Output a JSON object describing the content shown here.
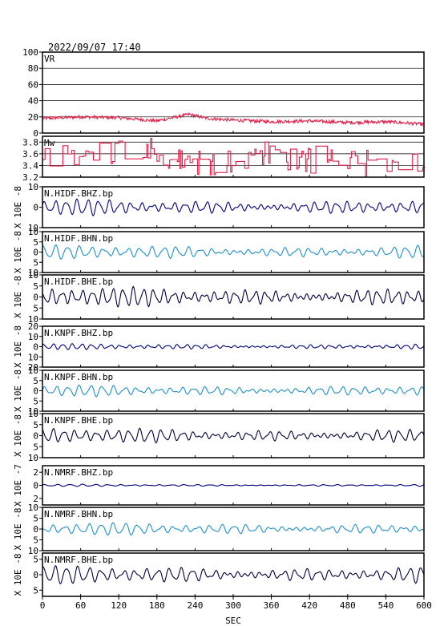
{
  "header": {
    "timestamp": "2022/09/07 17:40"
  },
  "chart_data": {
    "type": "line",
    "title": "",
    "xlabel": "SEC",
    "xlim": [
      0,
      600
    ],
    "xticks": [
      0,
      60,
      120,
      180,
      240,
      300,
      360,
      420,
      480,
      540,
      600
    ],
    "panels": [
      {
        "name": "VR",
        "ylim": [
          0,
          100
        ],
        "yticks": [
          0,
          20,
          40,
          60,
          80,
          100
        ],
        "ytick_labels": [
          "0",
          "20",
          "40",
          "60",
          "80",
          "100"
        ],
        "ylabel": "",
        "grid": true,
        "color": "#e0204a",
        "style": "vr",
        "series_summary": {
          "x": [
            0,
            60,
            120,
            180,
            230,
            260,
            300,
            360,
            420,
            480,
            540,
            600
          ],
          "y": [
            18,
            20,
            19,
            15,
            23,
            18,
            16,
            14,
            15,
            13,
            14,
            11
          ]
        }
      },
      {
        "name": "Mw",
        "ylim": [
          3.2,
          3.9
        ],
        "yticks": [
          3.2,
          3.4,
          3.6,
          3.8
        ],
        "ytick_labels": [
          "3.2",
          "3.4",
          "3.6",
          "3.8"
        ],
        "ylabel": "",
        "grid": true,
        "color": "#e0204a",
        "style": "mw",
        "series_summary": {
          "x": [
            0,
            100,
            150,
            200,
            300,
            360,
            420,
            480,
            540,
            600
          ],
          "y": [
            3.45,
            3.6,
            3.85,
            3.45,
            3.5,
            3.6,
            3.5,
            3.4,
            3.45,
            3.35
          ]
        }
      },
      {
        "name": "N.HIDF.BHZ.bp",
        "ylim": [
          -10,
          10
        ],
        "yticks": [
          -10,
          0,
          10
        ],
        "ytick_labels": [
          "10",
          "0",
          "10"
        ],
        "ylabel": "X 10E -8",
        "color": "#000080",
        "style": "obs",
        "amplitude": 3.5,
        "period_s": 17,
        "phase": 0.3,
        "series_summary": {
          "x": [
            0,
            600
          ],
          "y": [
            0,
            0
          ],
          "peak_amplitude": 4
        }
      },
      {
        "name": "N.HIDF.BHN.bp",
        "ylim": [
          -10,
          10
        ],
        "yticks": [
          -10,
          -5,
          0,
          5,
          10
        ],
        "ytick_labels": [
          "10",
          "5",
          "0",
          "5",
          "10"
        ],
        "ylabel": "X 10E -8",
        "color": "#1e90c8",
        "style": "obs",
        "amplitude": 3,
        "period_s": 19,
        "phase": 1.1,
        "series_summary": {
          "x": [
            0,
            600
          ],
          "y": [
            0,
            0
          ],
          "peak_amplitude": 4
        }
      },
      {
        "name": "N.HIDF.BHE.bp",
        "ylim": [
          -10,
          10
        ],
        "yticks": [
          -10,
          -5,
          0,
          5,
          10
        ],
        "ytick_labels": [
          "10",
          "5",
          "0",
          "5",
          "10"
        ],
        "ylabel": "X 10E -8",
        "color": "#000040",
        "style": "obs",
        "amplitude": 4,
        "period_s": 16,
        "phase": 2.0,
        "series_summary": {
          "x": [
            0,
            600
          ],
          "y": [
            0,
            0
          ],
          "peak_amplitude": 5
        }
      },
      {
        "name": "N.KNPF.BHZ.bp",
        "ylim": [
          -20,
          20
        ],
        "yticks": [
          -20,
          -10,
          0,
          10,
          20
        ],
        "ytick_labels": [
          "20",
          "10",
          "0",
          "10",
          "20"
        ],
        "ylabel": "X 10E -8",
        "color": "#000080",
        "style": "obs",
        "amplitude": 2.5,
        "period_s": 15,
        "phase": 0.7,
        "series_summary": {
          "x": [
            0,
            600
          ],
          "y": [
            0,
            0
          ],
          "peak_amplitude": 3
        }
      },
      {
        "name": "N.KNPF.BHN.bp",
        "ylim": [
          -10,
          10
        ],
        "yticks": [
          -10,
          -5,
          0,
          5,
          10
        ],
        "ytick_labels": [
          "10",
          "5",
          "0",
          "5",
          "10"
        ],
        "ylabel": "X 10E -8",
        "color": "#1e90c8",
        "style": "obs",
        "amplitude": 2.5,
        "period_s": 18,
        "phase": 0.2,
        "series_summary": {
          "x": [
            0,
            600
          ],
          "y": [
            0,
            0
          ],
          "peak_amplitude": 3
        }
      },
      {
        "name": "N.KNPF.BHE.bp",
        "ylim": [
          -10,
          10
        ],
        "yticks": [
          -10,
          -5,
          0,
          5,
          10
        ],
        "ytick_labels": [
          "10",
          "5",
          "0",
          "5",
          "10"
        ],
        "ylabel": "X 10E -8",
        "color": "#000040",
        "style": "obs",
        "amplitude": 3,
        "period_s": 17,
        "phase": 1.6,
        "series_summary": {
          "x": [
            0,
            600
          ],
          "y": [
            0,
            0
          ],
          "peak_amplitude": 4
        }
      },
      {
        "name": "N.NMRF.BHZ.bp",
        "ylim": [
          -3,
          3
        ],
        "yticks": [
          -2,
          0,
          2
        ],
        "ytick_labels": [
          "2",
          "0",
          "2"
        ],
        "ylabel": "X 10E -7",
        "color": "#000080",
        "style": "obs",
        "amplitude": 0.15,
        "period_s": 20,
        "phase": 0.5,
        "series_summary": {
          "x": [
            0,
            600
          ],
          "y": [
            0,
            0
          ],
          "peak_amplitude": 0.2
        }
      },
      {
        "name": "N.NMRF.BHN.bp",
        "ylim": [
          -10,
          10
        ],
        "yticks": [
          -10,
          -5,
          0,
          5,
          10
        ],
        "ytick_labels": [
          "10",
          "5",
          "0",
          "5",
          "10"
        ],
        "ylabel": "X 10E -8",
        "color": "#1e90c8",
        "style": "obs",
        "amplitude": 2.5,
        "period_s": 19,
        "phase": 2.4,
        "series_summary": {
          "x": [
            0,
            600
          ],
          "y": [
            0,
            0
          ],
          "peak_amplitude": 3.5
        }
      },
      {
        "name": "N.NMRF.BHE.bp",
        "ylim": [
          -7,
          7
        ],
        "yticks": [
          -5,
          0,
          5
        ],
        "ytick_labels": [
          "5",
          "0",
          "5"
        ],
        "ylabel": "X 10E -8",
        "color": "#000040",
        "style": "obs",
        "amplitude": 2.5,
        "period_s": 18,
        "phase": 0.9,
        "series_summary": {
          "x": [
            0,
            600
          ],
          "y": [
            0,
            0
          ],
          "peak_amplitude": 3
        }
      }
    ]
  }
}
